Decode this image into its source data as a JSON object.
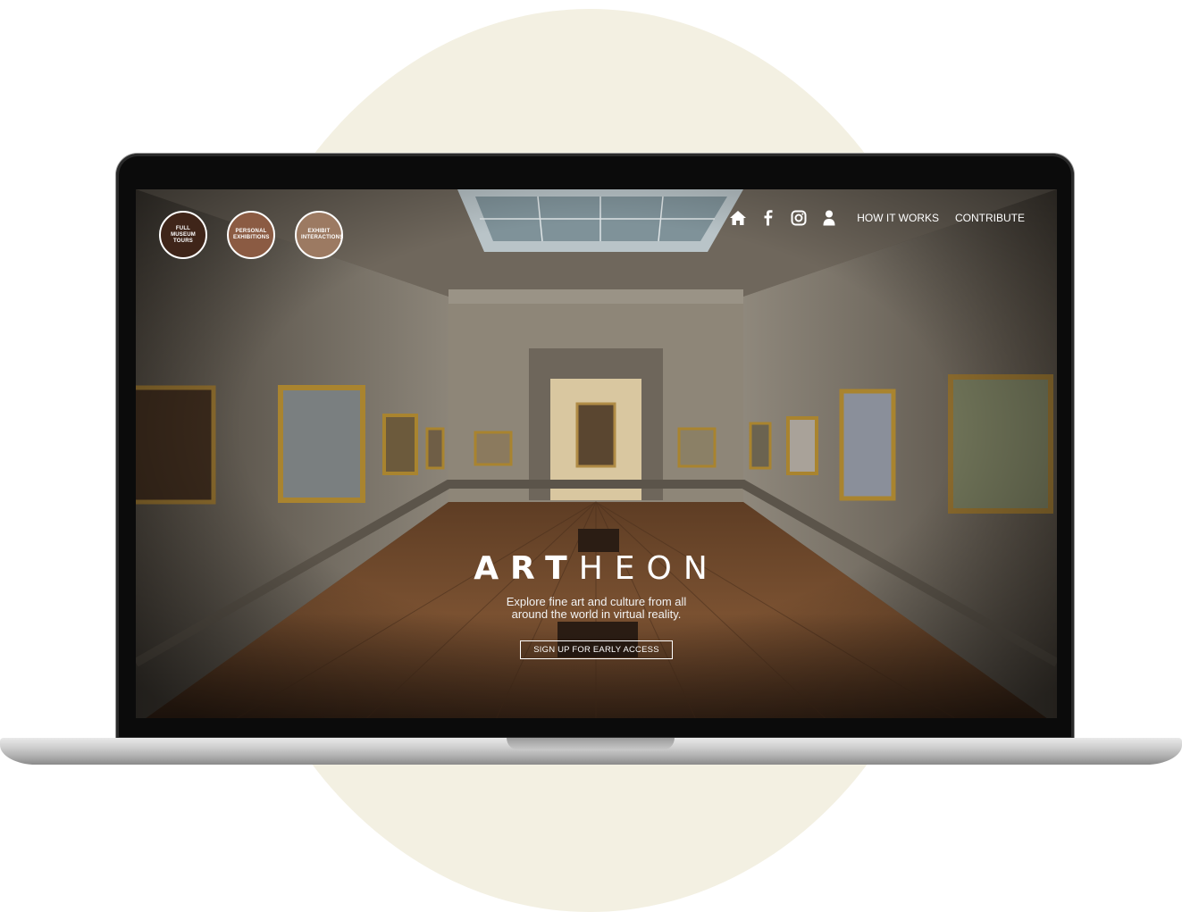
{
  "circle_nav": [
    {
      "label": "FULL MUSEUM TOURS",
      "color": "#3f2519"
    },
    {
      "label": "PERSONAL EXHIBITIONS",
      "color": "#8b5b43"
    },
    {
      "label": "EXHIBIT INTERACTIONS",
      "color": "#9c7a62"
    }
  ],
  "top_nav": {
    "icons": [
      "home-icon",
      "facebook-icon",
      "instagram-icon",
      "user-icon"
    ],
    "how_it_works": "HOW IT WORKS",
    "contribute": "CONTRIBUTE"
  },
  "hero": {
    "brand_bold": "ART",
    "brand_light": "HEON",
    "tagline": "Explore fine art and culture from all around the world in virtual reality.",
    "cta": "SIGN UP FOR EARLY ACCESS"
  },
  "colors": {
    "background_circle": "#f3f0e2",
    "wall": "#8e8678",
    "floor": "#6a4327"
  }
}
